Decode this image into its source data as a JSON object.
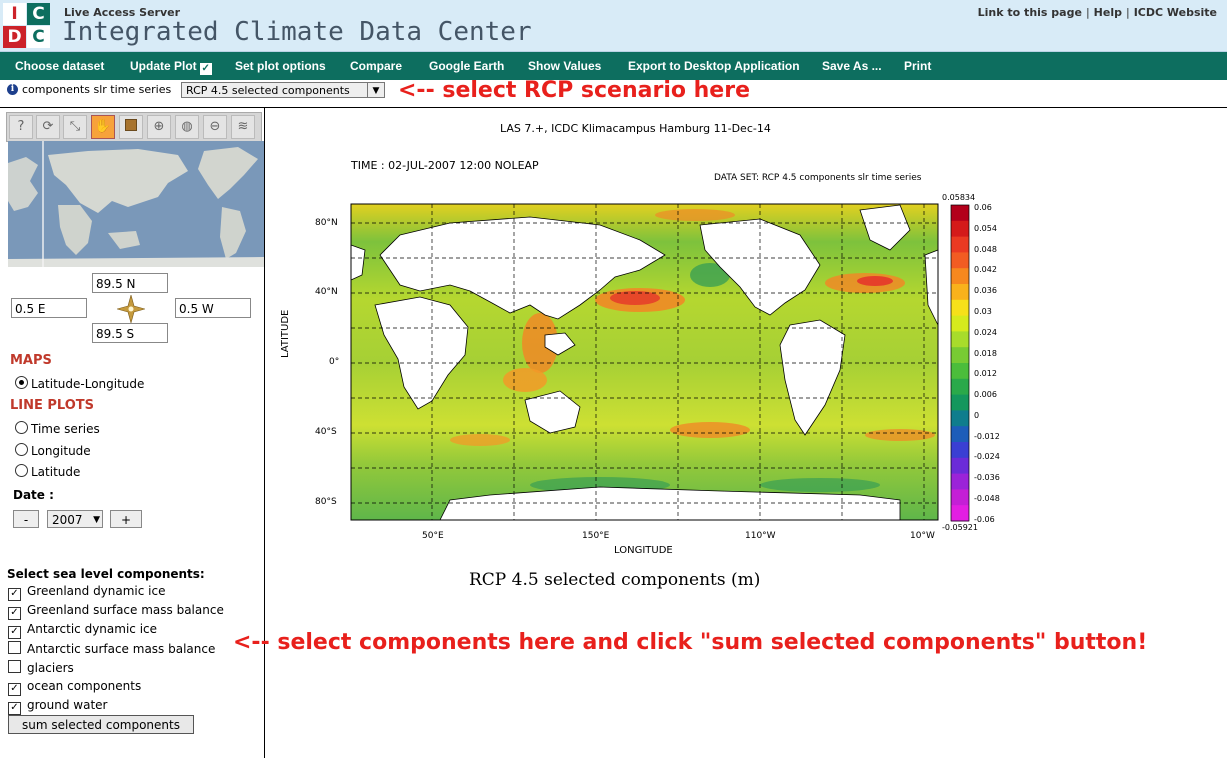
{
  "header": {
    "logo": {
      "l1": "I",
      "l2": "C",
      "l3": "D",
      "l4": "C"
    },
    "las_label": "Live Access Server",
    "title": "Integrated Climate Data Center",
    "links": [
      "Link to this page",
      "Help",
      "ICDC Website"
    ]
  },
  "menu": [
    "Choose dataset",
    "Update Plot",
    "Set plot options",
    "Compare",
    "Google Earth",
    "Show Values",
    "Export to Desktop Application",
    "Save As ...",
    "Print"
  ],
  "dataset": {
    "name": "components slr time series",
    "selected": "RCP 4.5 selected components",
    "annotation": "<-- select RCP scenario here"
  },
  "toolbar_icons": [
    "help-icon",
    "reset-icon",
    "pan-icon",
    "hand-icon",
    "box-icon",
    "zoom-in-icon",
    "globe-icon",
    "zoom-out-icon",
    "layers-icon"
  ],
  "region": {
    "north": "89.5 N",
    "south": "89.5 S",
    "west": "0.5 E",
    "east": "0.5 W"
  },
  "maps": {
    "heading": "MAPS",
    "option": "Latitude-Longitude"
  },
  "lineplots": {
    "heading": "LINE PLOTS",
    "options": [
      "Time series",
      "Longitude",
      "Latitude"
    ]
  },
  "date": {
    "label": "Date :",
    "minus": "-",
    "year": "2007",
    "plus": "+"
  },
  "components": {
    "heading": "Select sea level components:",
    "items": [
      {
        "label": "Greenland dynamic ice",
        "checked": true
      },
      {
        "label": "Greenland surface mass balance",
        "checked": true
      },
      {
        "label": "Antarctic dynamic ice",
        "checked": true
      },
      {
        "label": "Antarctic surface mass balance",
        "checked": false
      },
      {
        "label": "glaciers",
        "checked": false
      },
      {
        "label": "ocean components",
        "checked": true
      },
      {
        "label": "ground water",
        "checked": true
      }
    ],
    "button": "sum selected components",
    "annotation": "<-- select components here and click \"sum selected components\" button!"
  },
  "plot": {
    "header": "LAS 7.+, ICDC Klimacampus Hamburg 11-Dec-14",
    "time": "TIME : 02-JUL-2007 12:00 NOLEAP",
    "dataset": "DATA SET: RCP 4.5 components slr time series",
    "xlabel": "LONGITUDE",
    "ylabel": "LATITUDE",
    "xticks": [
      "50°E",
      "150°E",
      "110°W",
      "10°W"
    ],
    "yticks": [
      "80°N",
      "40°N",
      "0°",
      "40°S",
      "80°S"
    ],
    "colorbar_max": "0.05834",
    "colorbar_min": "-0.05921",
    "colorbar_ticks": [
      "0.06",
      "0.054",
      "0.048",
      "0.042",
      "0.036",
      "0.03",
      "0.024",
      "0.018",
      "0.012",
      "0.006",
      "0",
      "-0.012",
      "-0.024",
      "-0.036",
      "-0.048",
      "-0.06"
    ],
    "caption": "RCP 4.5 selected components (m)"
  },
  "colors": {
    "menu_bg": "#0d6e5f",
    "header_bg": "#d8ebf7",
    "annotation": "#e8201c",
    "section": "#c0392b"
  }
}
